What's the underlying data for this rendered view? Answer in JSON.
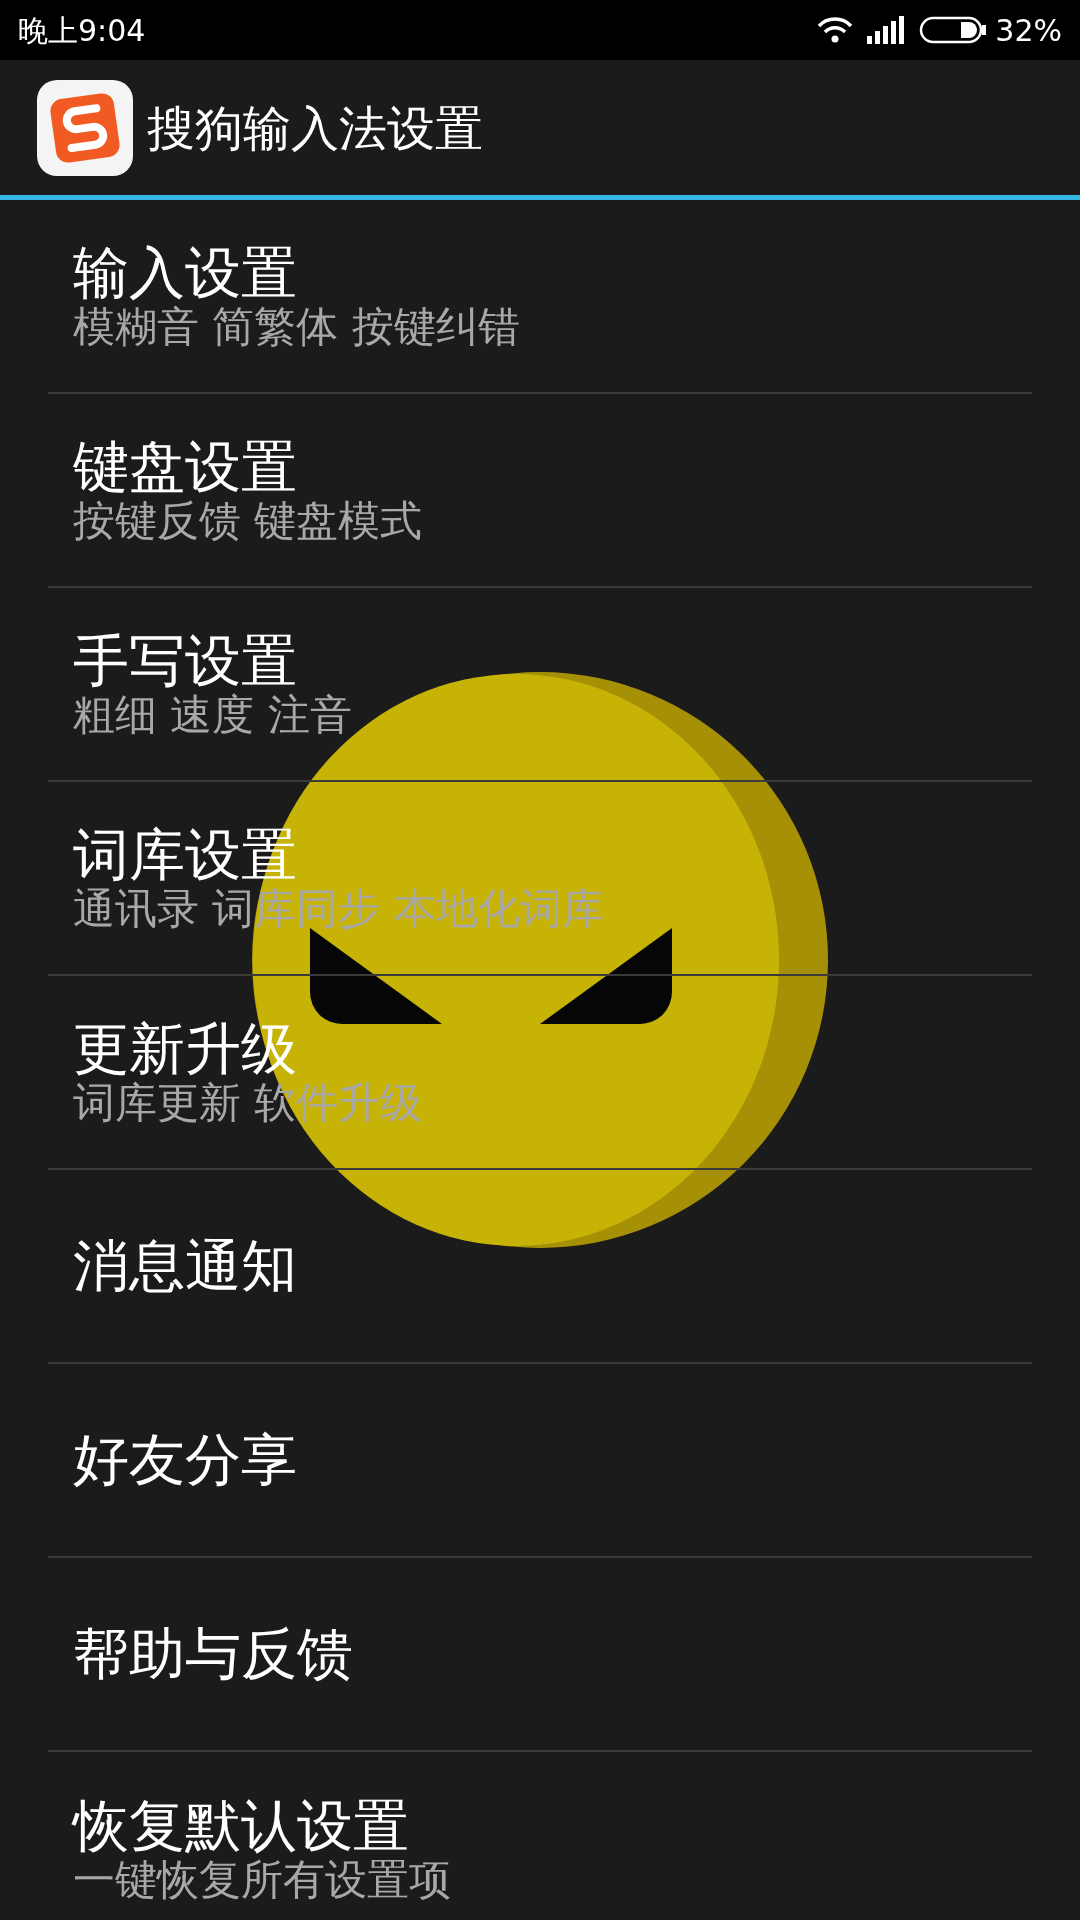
{
  "status_bar": {
    "time": "晚上9:04",
    "battery": "32%"
  },
  "app_bar": {
    "title": "搜狗输入法设置"
  },
  "items": [
    {
      "title": "输入设置",
      "summary": "模糊音 简繁体 按键纠错"
    },
    {
      "title": "键盘设置",
      "summary": "按键反馈 键盘模式"
    },
    {
      "title": "手写设置",
      "summary": "粗细 速度 注音"
    },
    {
      "title": "词库设置",
      "summary": "通讯录 词库同步 本地化词库"
    },
    {
      "title": "更新升级",
      "summary": "词库更新 软件升级"
    },
    {
      "title": "消息通知"
    },
    {
      "title": "好友分享"
    },
    {
      "title": "帮助与反馈"
    },
    {
      "title": "恢复默认设置",
      "summary": "一键恢复所有设置项"
    }
  ]
}
